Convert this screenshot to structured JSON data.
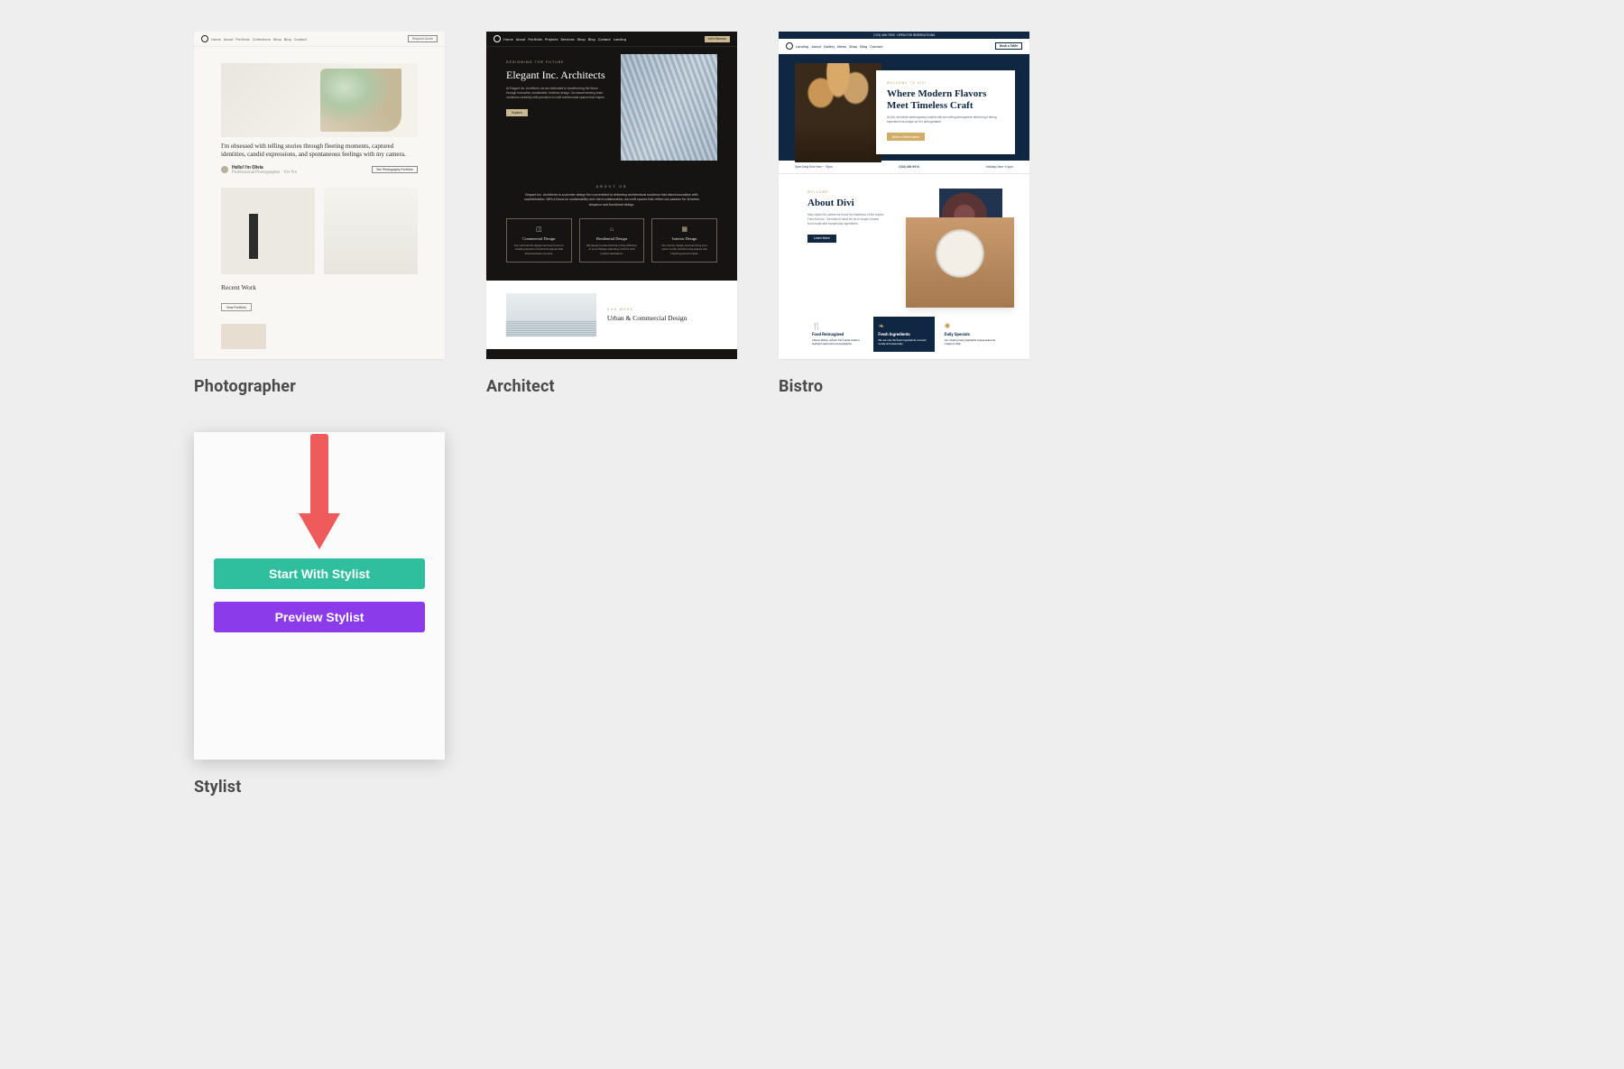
{
  "arrow_color": "#ef5b5b",
  "cards": [
    {
      "key": "photographer",
      "title": "Photographer",
      "nav": [
        "Home",
        "About",
        "Portfolio",
        "Collections",
        "Shop",
        "Blog",
        "Contact"
      ],
      "nav_cta": "Request Quote",
      "hero_tagline": "I'm obsessed with telling stories through fleeting moments, captured identities, candid expressions, and spontaneous feelings with my camera.",
      "author_label": "Hello! I'm Olivia",
      "author_sub": "Professional Photographer · 10+ Yrs",
      "author_cta": "See Photography Portfolio",
      "recent_heading": "Recent Work",
      "recent_cta": "View Portfolio"
    },
    {
      "key": "architect",
      "title": "Architect",
      "nav": [
        "Home",
        "About",
        "Portfolio",
        "Projects",
        "Services",
        "Shop",
        "Blog",
        "Contact",
        "Landing"
      ],
      "nav_cta": "Let's Discuss",
      "eyebrow": "DESIGNING THE FUTURE",
      "hero_title": "Elegant Inc. Architects",
      "hero_copy": "At Elegant Inc. Architects, we are dedicated to transforming the future through innovative, sustainable, timeless design. Our award-winning team combines creativity with precision to craft architectural spaces that inspire.",
      "hero_cta": "Explore",
      "about_eyebrow": "ABOUT US",
      "about_copy": "Elegant Inc. Architects is a premier design firm committed to delivering architectural solutions that blend innovation with sophistication. With a focus on sustainability and client collaboration, we craft spaces that reflect our passion for timeless elegance and functional design.",
      "service_cards": [
        {
          "icon": "◫",
          "title": "Commercial Design",
          "copy": "Our commercial design services focus on creating dynamic functional spaces that drive business success."
        },
        {
          "icon": "⌂",
          "title": "Residential Design",
          "copy": "We design homes that are a true reflection of your lifestyle, blending comfort with modern aesthetics."
        },
        {
          "icon": "▦",
          "title": "Interior Design",
          "copy": "Our interior design services bring your vision to life, transforming spaces into inspiring environments."
        }
      ],
      "portfolio_eyebrow": "OUR WORK",
      "portfolio_title": "Urban & Commercial Design"
    },
    {
      "key": "bistro",
      "title": "Bistro",
      "announcement": "(123) 456-7890 · OPEN FOR RESERVATIONS",
      "nav": [
        "Landing",
        "About",
        "Gallery",
        "Menu",
        "Shop",
        "Blog",
        "Contact"
      ],
      "nav_cta": "Book a Table",
      "hero_eyebrow": "WELCOME TO DIVI",
      "hero_title": "Where Modern Flavors Meet Timeless Craft",
      "hero_copy": "At Divi, we blend contemporary cuisine with an inviting atmosphere, delivering a dining experience as unique as it is unforgettable.",
      "hero_cta": "Book a Reservation",
      "info_strip": [
        "Open Daily from 9am – 10pm",
        "(234) 456-8910",
        "Holidays 9am–6.4pm"
      ],
      "about_eyebrow": "WELCOME",
      "about_title": "About Divi",
      "about_copy": "Step inside Divi, where we honor the traditions of the classic French bistro. The heart of what we do is simple, honest food made with exceptional ingredients.",
      "about_cta": "Learn More",
      "tiles": [
        {
          "icon": "🍴",
          "title": "Food Reimagined",
          "copy": "Classic dishes, refined. Each plate made to highlight seasonal local ingredients.",
          "variant": "wht"
        },
        {
          "icon": "❧",
          "title": "Fresh Ingredients",
          "copy": "We use only the finest ingredients, sourced locally and seasonally.",
          "variant": "blu"
        },
        {
          "icon": "✺",
          "title": "Daily Specials",
          "copy": "Our rotating menu highlights unique seasonal creations daily.",
          "variant": "wht"
        }
      ]
    },
    {
      "key": "stylist",
      "title": "Stylist",
      "start_label": "Start With Stylist",
      "preview_label": "Preview Stylist"
    }
  ]
}
